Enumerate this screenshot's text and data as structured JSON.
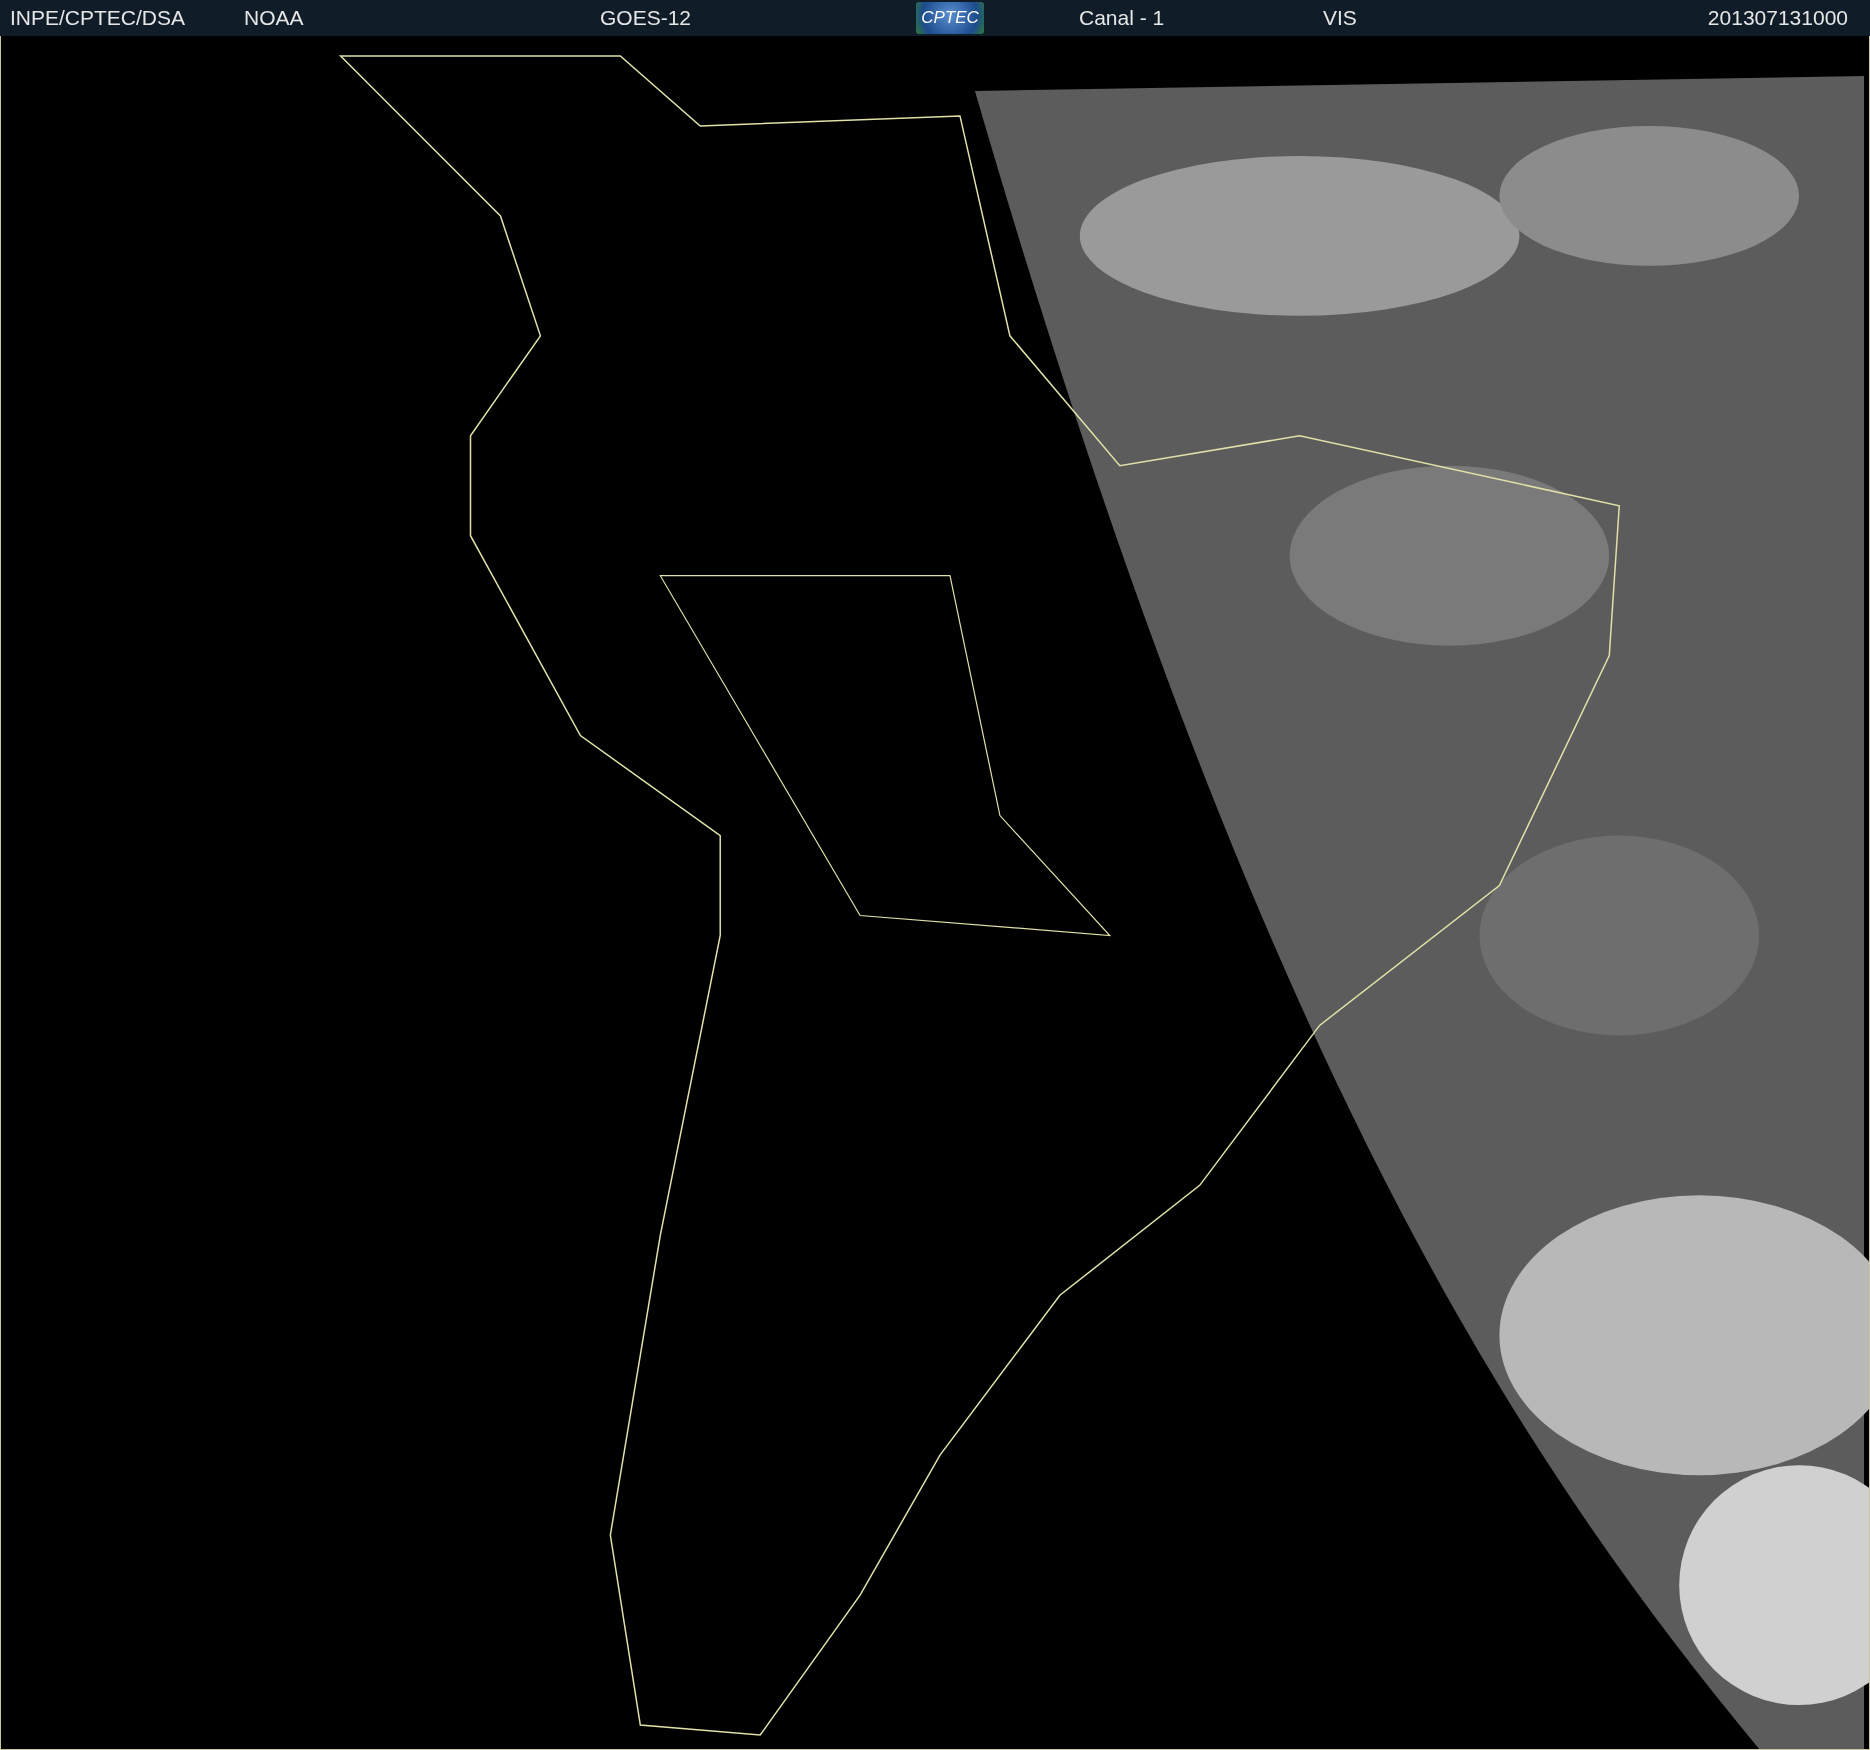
{
  "header": {
    "source": "INPE/CPTEC/DSA",
    "agency": "NOAA",
    "satellite": "GOES-12",
    "logo": "CPTEC",
    "channel": "Canal - 1",
    "band": "VIS",
    "timestamp": "201307131000"
  }
}
